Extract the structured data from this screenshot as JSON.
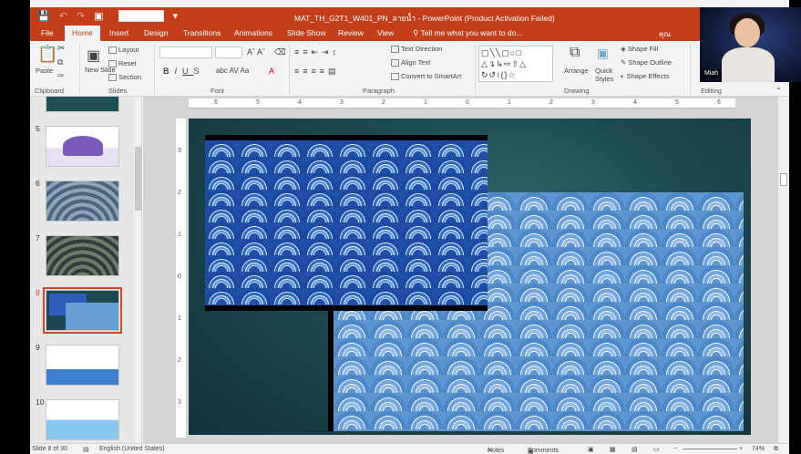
{
  "colors": {
    "accent": "#c43e1c",
    "selected_thumb": "#d24726"
  },
  "titlebar": {
    "title": "MAT_TH_G2T1_W401_PN_ลายน้ำ - PowerPoint (Product Activation Failed)"
  },
  "tabs": {
    "file": "File",
    "home": "Home",
    "insert": "Insert",
    "design": "Design",
    "transitions": "Transitions",
    "animations": "Animations",
    "slideshow": "Slide Show",
    "review": "Review",
    "view": "View",
    "tellme": "Tell me what you want to do...",
    "account": "คุณ"
  },
  "ribbon": {
    "clipboard": {
      "label": "Clipboard",
      "paste": "Paste"
    },
    "slides": {
      "label": "Slides",
      "new_slide": "New Slide",
      "layout": "Layout",
      "reset": "Reset",
      "section": "Section"
    },
    "font": {
      "label": "Font"
    },
    "paragraph": {
      "label": "Paragraph",
      "text_direction": "Text Direction",
      "align_text": "Align Text",
      "convert_smartart": "Convert to SmartArt"
    },
    "drawing": {
      "label": "Drawing",
      "arrange": "Arrange",
      "quick_styles": "Quick Styles",
      "shape_fill": "Shape Fill",
      "shape_outline": "Shape Outline",
      "shape_effects": "Shape Effects"
    },
    "editing": {
      "label": "Editing"
    }
  },
  "thumbnails": [
    {
      "num": "5"
    },
    {
      "num": "6"
    },
    {
      "num": "7"
    },
    {
      "num": "8"
    },
    {
      "num": "9"
    },
    {
      "num": "10"
    }
  ],
  "ruler": {
    "h": [
      "6",
      "5",
      "4",
      "3",
      "2",
      "1",
      "0",
      "1",
      "2",
      "3",
      "4",
      "5",
      "6"
    ],
    "v": [
      "3",
      "2",
      "1",
      "0",
      "1",
      "2",
      "3"
    ]
  },
  "status": {
    "slide": "Slide 8 of 30",
    "language": "English (United States)",
    "notes": "Notes",
    "comments": "Comments",
    "zoom": "74%"
  },
  "webcam": {
    "name": "Miah"
  }
}
